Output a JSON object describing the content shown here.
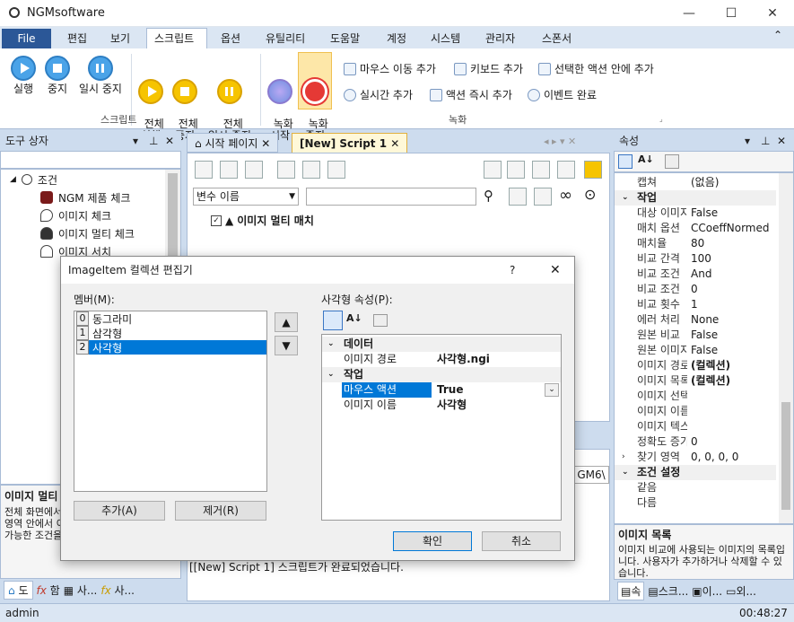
{
  "window": {
    "title": "NGMsoftware"
  },
  "menu": {
    "file": "File",
    "items": [
      "편집",
      "보기",
      "스크립트",
      "옵션",
      "유틸리티",
      "도움말",
      "계정",
      "시스템",
      "관리자",
      "스폰서"
    ]
  },
  "ribbon": {
    "script": {
      "run": "실행",
      "stop": "중지",
      "pause": "일시 중지",
      "run_all": "전체\n실행",
      "stop_all": "전체\n중지",
      "pause_all": "전체\n일시 중지",
      "group": "스크립트"
    },
    "record": {
      "start": "녹화\n시작",
      "stop": "녹화\n중지",
      "mouse_move": "마우스 이동 추가",
      "keyboard": "키보드 추가",
      "selected_action": "선택한 액션 안에 추가",
      "realtime": "실시간 추가",
      "action_now": "액션 즉시 추가",
      "event_done": "이벤트 완료",
      "group": "녹화"
    }
  },
  "toolbox": {
    "title": "도구 상자",
    "root": "조건",
    "items": [
      "NGM 제품 체크",
      "이미지 체크",
      "이미지 멀티 체크",
      "이미지 서치"
    ],
    "desc_title": "이미지 멀티",
    "desc_text": "전체 화면에서 이미지를 찾습니다. 또는 영역 안에서 이미지를 찾습니다. 설정이 가능한 조건을 설정합니다.",
    "bottom_tabs": [
      "도",
      "함",
      "사...",
      "사..."
    ]
  },
  "editor": {
    "tabs": [
      "시작 페이지",
      "[New] Script 1"
    ],
    "var_select": "변수 이름",
    "node_label": "이미지 멀티 매치",
    "output_tab": "GM6\\",
    "output_text": "[[New] Script 1] 스크립트가 완료되었습니다."
  },
  "props": {
    "title": "속성",
    "rows": [
      {
        "k": "캡쳐",
        "v": "(없음)"
      },
      {
        "cat": "작업"
      },
      {
        "k": "대상 이미지",
        "v": "False"
      },
      {
        "k": "매치 옵션",
        "v": "CCoeffNormed"
      },
      {
        "k": "매치율",
        "v": "80"
      },
      {
        "k": "비교 간격",
        "v": "100"
      },
      {
        "k": "비교 조건",
        "v": "And"
      },
      {
        "k": "비교 조건",
        "v": "0"
      },
      {
        "k": "비교 횟수",
        "v": "1"
      },
      {
        "k": "에러 처리",
        "v": "None"
      },
      {
        "k": "원본 비교",
        "v": "False"
      },
      {
        "k": "원본 이미지",
        "v": "False"
      },
      {
        "k": "이미지 경로",
        "v": "(컬렉션)",
        "b": true
      },
      {
        "k": "이미지 목록",
        "v": "(컬렉션)",
        "b": true
      },
      {
        "k": "이미지 선택",
        "v": ""
      },
      {
        "k": "이미지 이름",
        "v": ""
      },
      {
        "k": "이미지 텍스트",
        "v": ""
      },
      {
        "k": "정확도 증가",
        "v": "0"
      },
      {
        "k": "찾기 영역",
        "v": "0, 0, 0, 0"
      },
      {
        "cat": "조건 설정"
      },
      {
        "k": "같음",
        "v": ""
      },
      {
        "k": "다름",
        "v": ""
      }
    ],
    "desc_title": "이미지 목록",
    "desc_text": "이미지 비교에 사용되는 이미지의 목록입니다. 사용자가 추가하거나 삭제할 수 있습니다.",
    "bottom_tabs": [
      "속",
      "스크...",
      "이...",
      "외..."
    ]
  },
  "dialog": {
    "title": "ImageItem 컬렉션 편집기",
    "help": "?",
    "members_label": "멤버(M):",
    "members": [
      {
        "i": "0",
        "n": "동그라미"
      },
      {
        "i": "1",
        "n": "삼각형"
      },
      {
        "i": "2",
        "n": "사각형"
      }
    ],
    "props_label": "사각형 속성(P):",
    "cat1": "데이터",
    "path_k": "이미지 경로",
    "path_v": "사각형.ngi",
    "cat2": "작업",
    "mouse_k": "마우스 액션",
    "mouse_v": "True",
    "name_k": "이미지 이름",
    "name_v": "사각형",
    "add": "추가(A)",
    "remove": "제거(R)",
    "ok": "확인",
    "cancel": "취소"
  },
  "status": {
    "user": "admin",
    "time": "00:48:27"
  }
}
